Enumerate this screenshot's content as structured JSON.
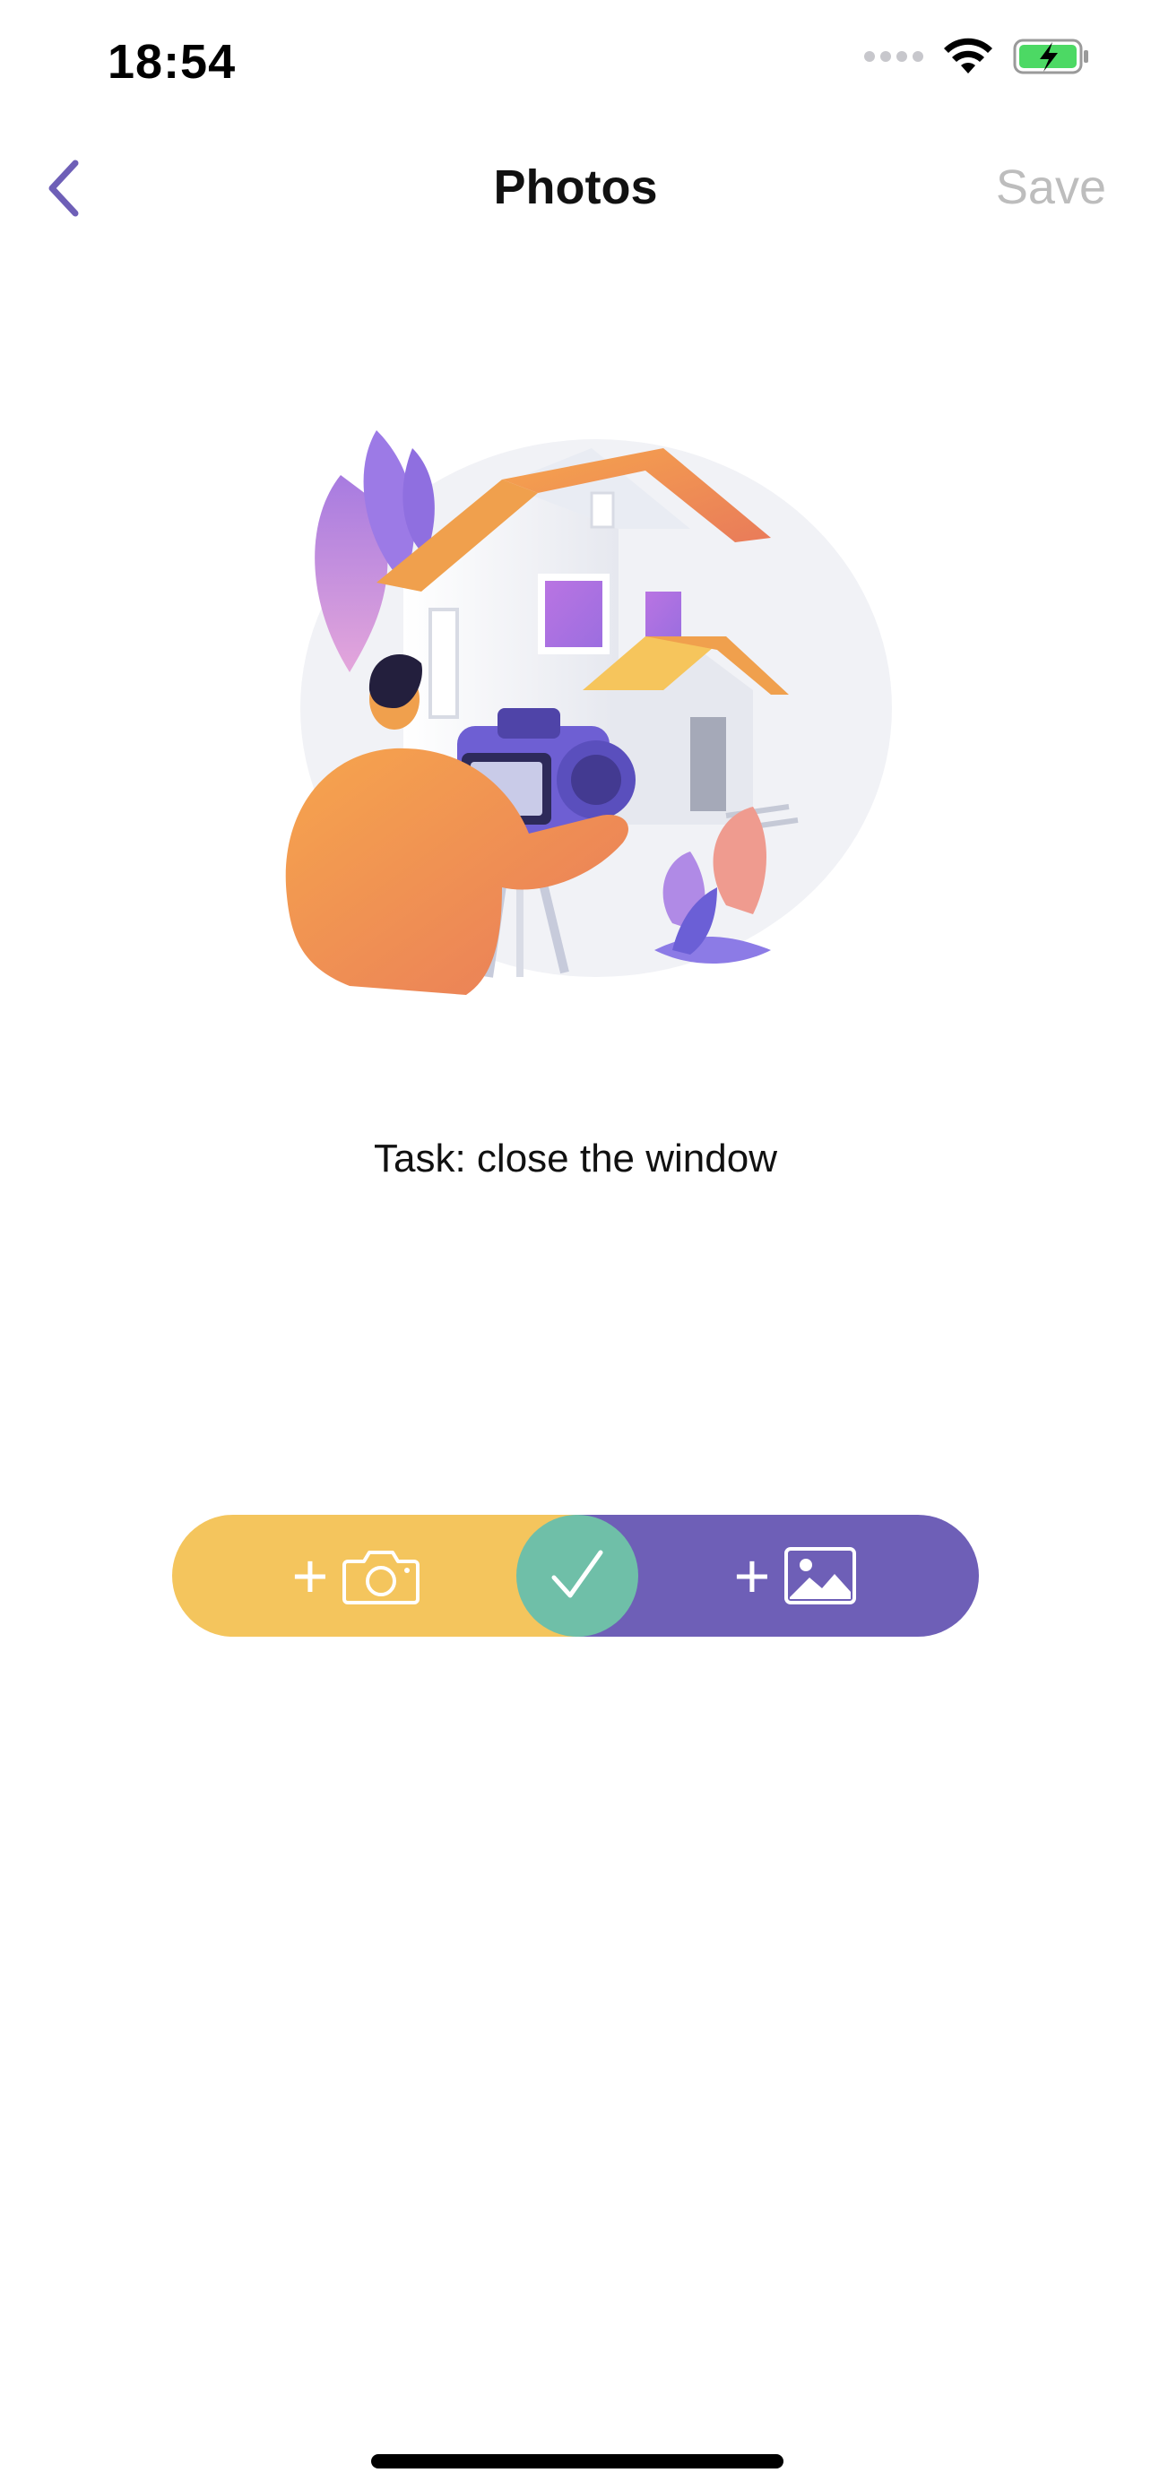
{
  "status_bar": {
    "time": "18:54"
  },
  "nav": {
    "title": "Photos",
    "save_label": "Save",
    "back_icon": "chevron-left-icon"
  },
  "task": {
    "text": "Task: close the window"
  },
  "actions": {
    "take_photo_icon": "camera-icon",
    "confirm_icon": "checkmark-icon",
    "add_image_icon": "image-icon",
    "plus_symbol": "+"
  },
  "colors": {
    "accent_purple": "#6e5fb7",
    "accent_yellow": "#f4c55d",
    "accent_green": "#6fbfa8",
    "disabled_text": "#bdbdbd"
  }
}
